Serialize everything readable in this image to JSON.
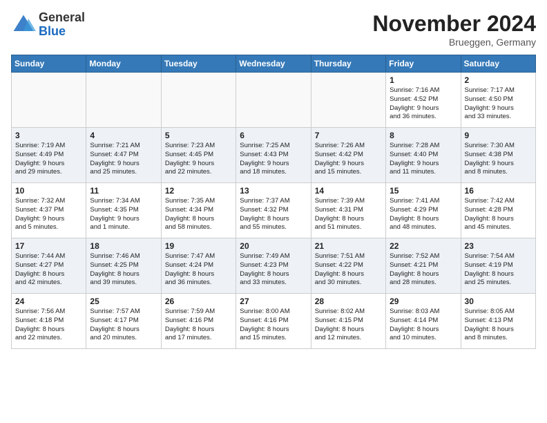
{
  "header": {
    "logo_general": "General",
    "logo_blue": "Blue",
    "month_title": "November 2024",
    "location": "Brueggen, Germany"
  },
  "weekdays": [
    "Sunday",
    "Monday",
    "Tuesday",
    "Wednesday",
    "Thursday",
    "Friday",
    "Saturday"
  ],
  "weeks": [
    {
      "alt": false,
      "days": [
        {
          "number": "",
          "info": ""
        },
        {
          "number": "",
          "info": ""
        },
        {
          "number": "",
          "info": ""
        },
        {
          "number": "",
          "info": ""
        },
        {
          "number": "",
          "info": ""
        },
        {
          "number": "1",
          "info": "Sunrise: 7:16 AM\nSunset: 4:52 PM\nDaylight: 9 hours\nand 36 minutes."
        },
        {
          "number": "2",
          "info": "Sunrise: 7:17 AM\nSunset: 4:50 PM\nDaylight: 9 hours\nand 33 minutes."
        }
      ]
    },
    {
      "alt": true,
      "days": [
        {
          "number": "3",
          "info": "Sunrise: 7:19 AM\nSunset: 4:49 PM\nDaylight: 9 hours\nand 29 minutes."
        },
        {
          "number": "4",
          "info": "Sunrise: 7:21 AM\nSunset: 4:47 PM\nDaylight: 9 hours\nand 25 minutes."
        },
        {
          "number": "5",
          "info": "Sunrise: 7:23 AM\nSunset: 4:45 PM\nDaylight: 9 hours\nand 22 minutes."
        },
        {
          "number": "6",
          "info": "Sunrise: 7:25 AM\nSunset: 4:43 PM\nDaylight: 9 hours\nand 18 minutes."
        },
        {
          "number": "7",
          "info": "Sunrise: 7:26 AM\nSunset: 4:42 PM\nDaylight: 9 hours\nand 15 minutes."
        },
        {
          "number": "8",
          "info": "Sunrise: 7:28 AM\nSunset: 4:40 PM\nDaylight: 9 hours\nand 11 minutes."
        },
        {
          "number": "9",
          "info": "Sunrise: 7:30 AM\nSunset: 4:38 PM\nDaylight: 9 hours\nand 8 minutes."
        }
      ]
    },
    {
      "alt": false,
      "days": [
        {
          "number": "10",
          "info": "Sunrise: 7:32 AM\nSunset: 4:37 PM\nDaylight: 9 hours\nand 5 minutes."
        },
        {
          "number": "11",
          "info": "Sunrise: 7:34 AM\nSunset: 4:35 PM\nDaylight: 9 hours\nand 1 minute."
        },
        {
          "number": "12",
          "info": "Sunrise: 7:35 AM\nSunset: 4:34 PM\nDaylight: 8 hours\nand 58 minutes."
        },
        {
          "number": "13",
          "info": "Sunrise: 7:37 AM\nSunset: 4:32 PM\nDaylight: 8 hours\nand 55 minutes."
        },
        {
          "number": "14",
          "info": "Sunrise: 7:39 AM\nSunset: 4:31 PM\nDaylight: 8 hours\nand 51 minutes."
        },
        {
          "number": "15",
          "info": "Sunrise: 7:41 AM\nSunset: 4:29 PM\nDaylight: 8 hours\nand 48 minutes."
        },
        {
          "number": "16",
          "info": "Sunrise: 7:42 AM\nSunset: 4:28 PM\nDaylight: 8 hours\nand 45 minutes."
        }
      ]
    },
    {
      "alt": true,
      "days": [
        {
          "number": "17",
          "info": "Sunrise: 7:44 AM\nSunset: 4:27 PM\nDaylight: 8 hours\nand 42 minutes."
        },
        {
          "number": "18",
          "info": "Sunrise: 7:46 AM\nSunset: 4:25 PM\nDaylight: 8 hours\nand 39 minutes."
        },
        {
          "number": "19",
          "info": "Sunrise: 7:47 AM\nSunset: 4:24 PM\nDaylight: 8 hours\nand 36 minutes."
        },
        {
          "number": "20",
          "info": "Sunrise: 7:49 AM\nSunset: 4:23 PM\nDaylight: 8 hours\nand 33 minutes."
        },
        {
          "number": "21",
          "info": "Sunrise: 7:51 AM\nSunset: 4:22 PM\nDaylight: 8 hours\nand 30 minutes."
        },
        {
          "number": "22",
          "info": "Sunrise: 7:52 AM\nSunset: 4:21 PM\nDaylight: 8 hours\nand 28 minutes."
        },
        {
          "number": "23",
          "info": "Sunrise: 7:54 AM\nSunset: 4:19 PM\nDaylight: 8 hours\nand 25 minutes."
        }
      ]
    },
    {
      "alt": false,
      "days": [
        {
          "number": "24",
          "info": "Sunrise: 7:56 AM\nSunset: 4:18 PM\nDaylight: 8 hours\nand 22 minutes."
        },
        {
          "number": "25",
          "info": "Sunrise: 7:57 AM\nSunset: 4:17 PM\nDaylight: 8 hours\nand 20 minutes."
        },
        {
          "number": "26",
          "info": "Sunrise: 7:59 AM\nSunset: 4:16 PM\nDaylight: 8 hours\nand 17 minutes."
        },
        {
          "number": "27",
          "info": "Sunrise: 8:00 AM\nSunset: 4:16 PM\nDaylight: 8 hours\nand 15 minutes."
        },
        {
          "number": "28",
          "info": "Sunrise: 8:02 AM\nSunset: 4:15 PM\nDaylight: 8 hours\nand 12 minutes."
        },
        {
          "number": "29",
          "info": "Sunrise: 8:03 AM\nSunset: 4:14 PM\nDaylight: 8 hours\nand 10 minutes."
        },
        {
          "number": "30",
          "info": "Sunrise: 8:05 AM\nSunset: 4:13 PM\nDaylight: 8 hours\nand 8 minutes."
        }
      ]
    }
  ]
}
